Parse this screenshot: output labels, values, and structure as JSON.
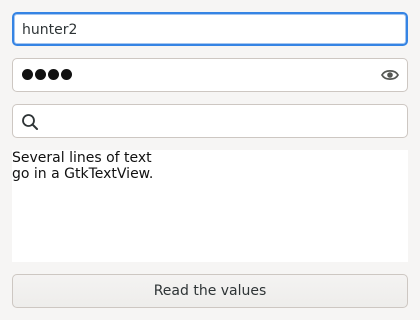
{
  "text_entry": {
    "value": "hunter2"
  },
  "password_entry": {
    "masked_char_count": 4,
    "reveal_icon": "eye-icon"
  },
  "search_entry": {
    "icon": "search-icon",
    "value": ""
  },
  "text_view": {
    "lines": [
      "Several lines of text",
      "go in a GtkTextView."
    ]
  },
  "button": {
    "label": "Read the values"
  }
}
